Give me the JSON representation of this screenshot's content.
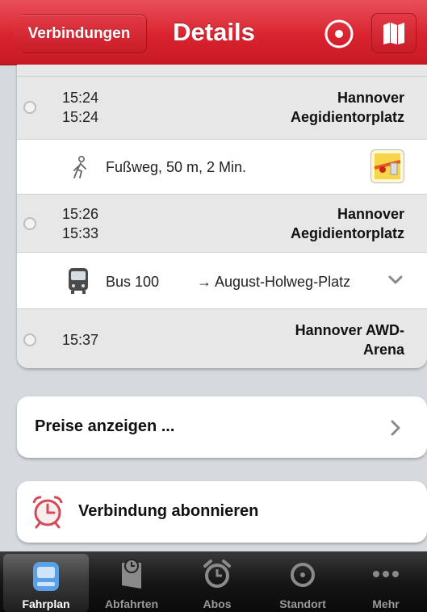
{
  "nav": {
    "back_label": "Verbindungen",
    "title": "Details"
  },
  "connection": {
    "stop1": {
      "time_arr": "15:24",
      "time_dep": "15:24",
      "name_line1": "Hannover",
      "name_line2": "Aegidientorplatz"
    },
    "walk": {
      "text": "Fußweg, 50 m, 2 Min."
    },
    "stop2": {
      "time_arr": "15:26",
      "time_dep": "15:33",
      "name_line1": "Hannover",
      "name_line2": "Aegidientorplatz"
    },
    "bus": {
      "line": "Bus 100",
      "direction": "→ August-Holweg-Platz"
    },
    "stop3": {
      "time": "15:37",
      "name_line1": "Hannover AWD-",
      "name_line2": "Arena"
    }
  },
  "actions": {
    "prices_label": "Preise anzeigen ...",
    "subscribe_label": "Verbindung abonnieren"
  },
  "tabbar": {
    "tabs": [
      {
        "label": "Fahrplan",
        "icon": "train-icon",
        "active": true
      },
      {
        "label": "Abfahrten",
        "icon": "departures-icon",
        "active": false
      },
      {
        "label": "Abos",
        "icon": "alarm-clock-icon",
        "active": false
      },
      {
        "label": "Standort",
        "icon": "locate-icon",
        "active": false
      },
      {
        "label": "Mehr",
        "icon": "more-icon",
        "active": false
      }
    ]
  },
  "colors": {
    "accent": "#d9232f",
    "tab_active": "#5aa0e6"
  }
}
